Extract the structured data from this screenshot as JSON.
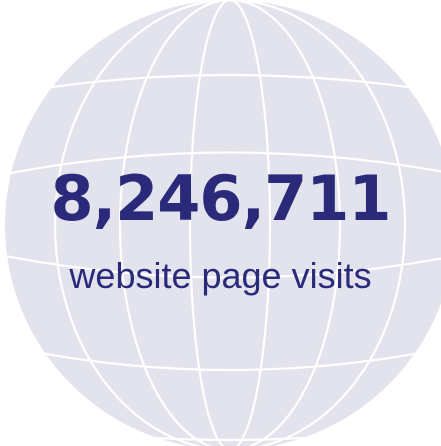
{
  "stat": {
    "value": "8,246,711",
    "label": "website page visits"
  },
  "colors": {
    "globe_fill": "#e2e3ec",
    "globe_lines": "#ffffff",
    "text": "#2b2a7a"
  },
  "icon": "globe-icon"
}
